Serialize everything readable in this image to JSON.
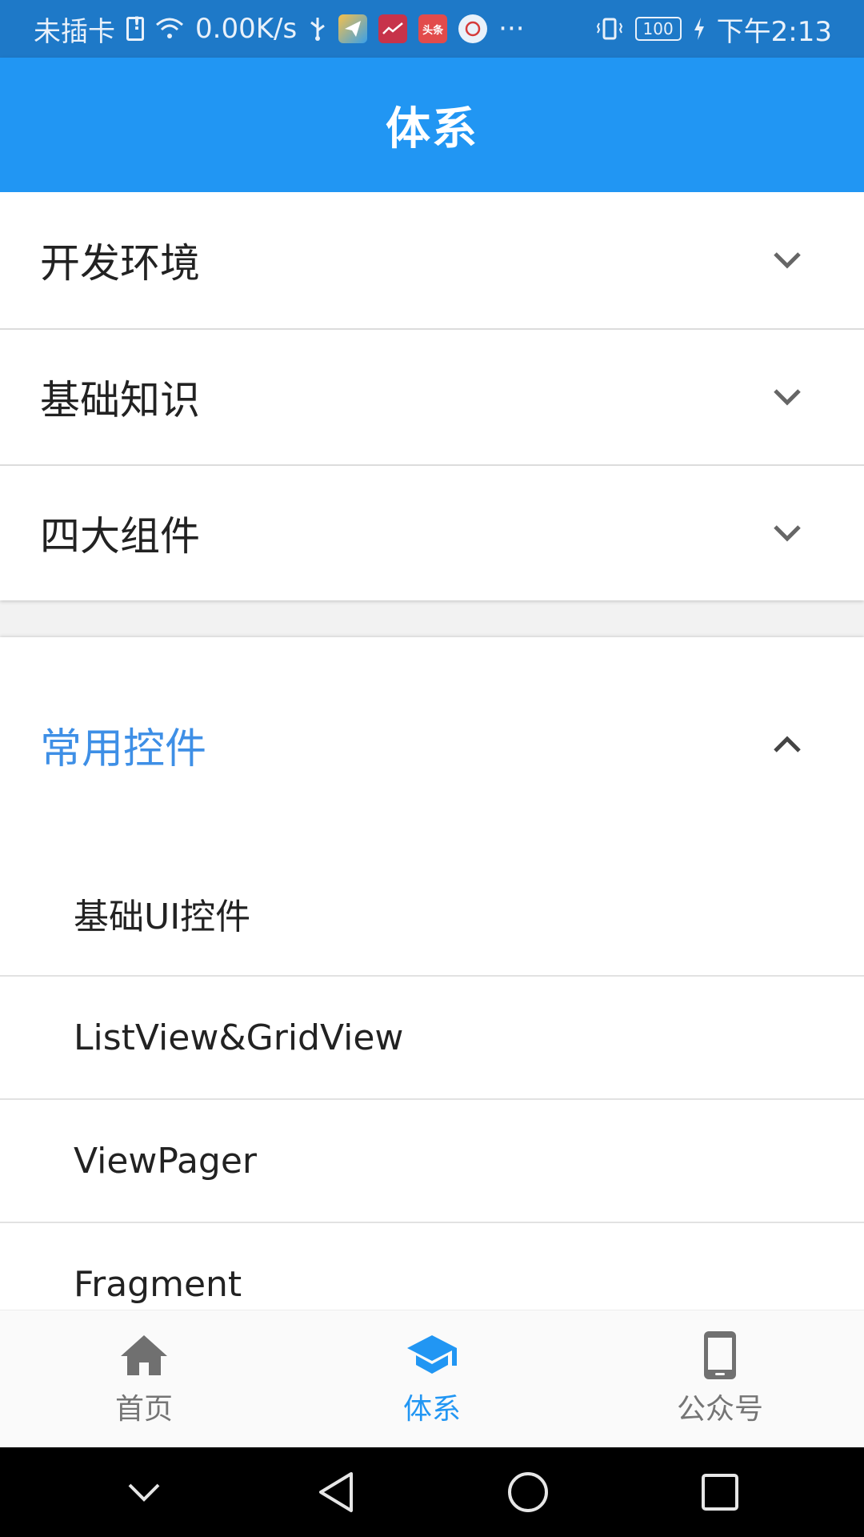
{
  "status_bar": {
    "carrier": "未插卡",
    "net_speed": "0.00K/s",
    "app_badge_3": "头条",
    "more": "···",
    "battery": "100",
    "time": "下午2:13"
  },
  "app_bar": {
    "title": "体系"
  },
  "categories": [
    {
      "label": "开发环境"
    },
    {
      "label": "基础知识"
    },
    {
      "label": "四大组件"
    }
  ],
  "expanded_category": {
    "label": "常用控件",
    "items": [
      {
        "label": "基础UI控件"
      },
      {
        "label": "ListView&GridView"
      },
      {
        "label": "ViewPager"
      },
      {
        "label": "Fragment"
      }
    ]
  },
  "bottom_nav": [
    {
      "label": "首页",
      "icon": "home-icon",
      "active": false
    },
    {
      "label": "体系",
      "icon": "school-icon",
      "active": true
    },
    {
      "label": "公众号",
      "icon": "phone-icon",
      "active": false
    }
  ],
  "colors": {
    "primary": "#2196f3",
    "status_bar": "#1e79c8",
    "expanded_accent": "#3e8fe6"
  }
}
